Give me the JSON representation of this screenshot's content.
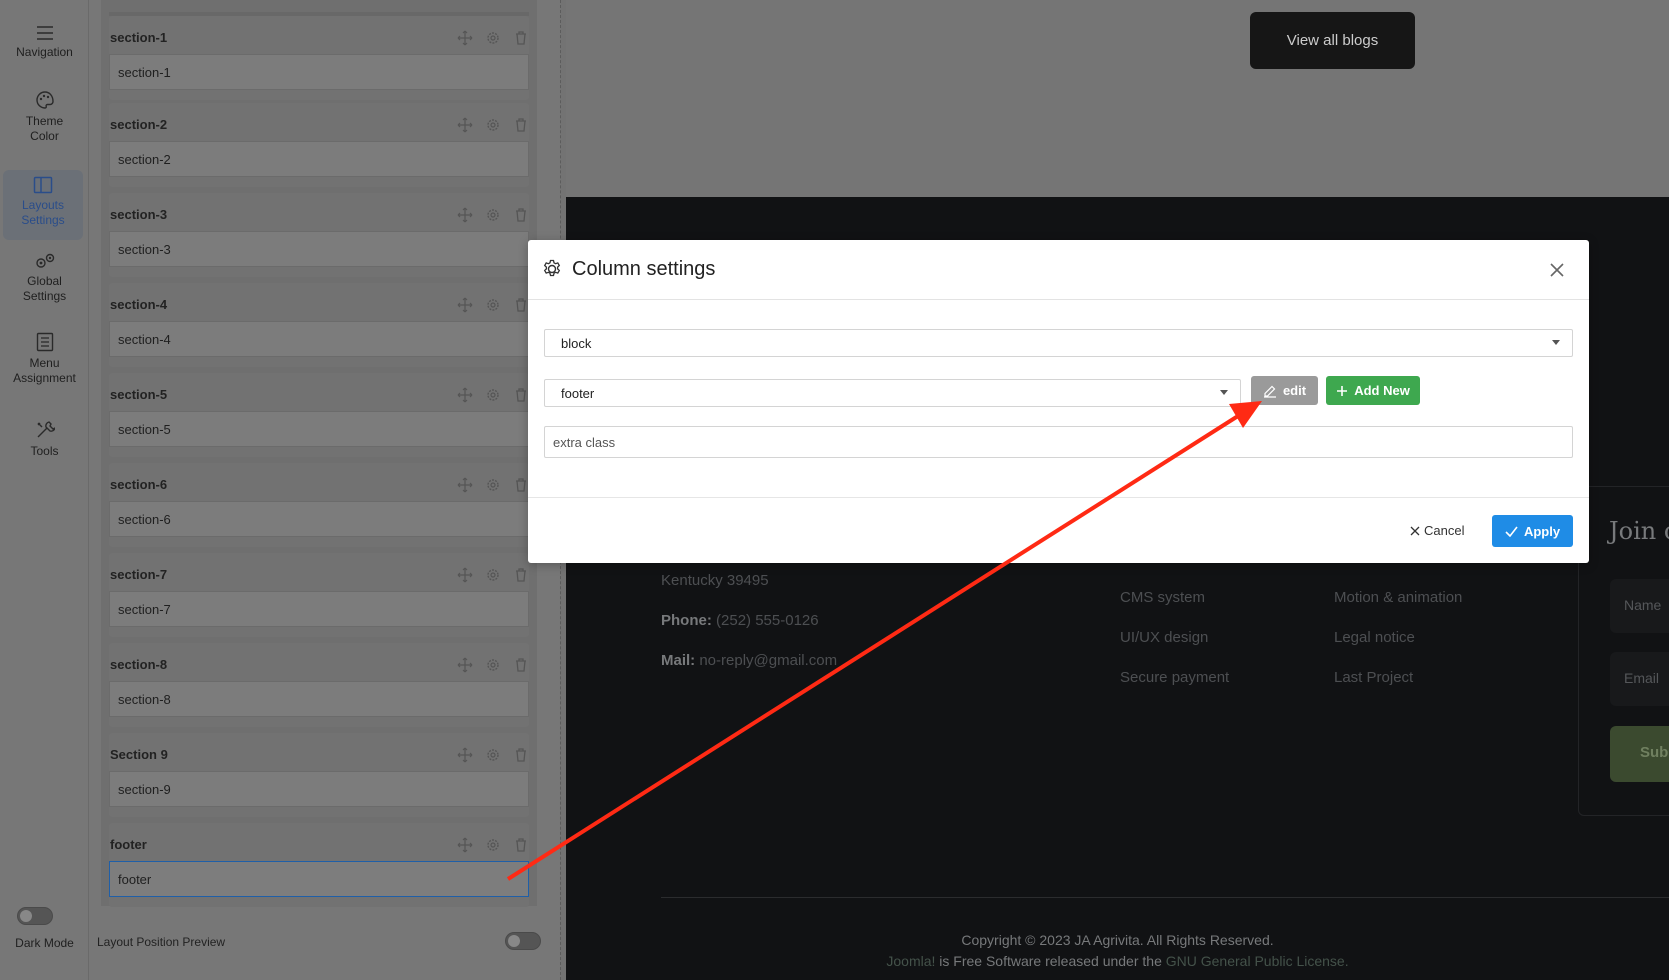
{
  "nav": {
    "items": [
      {
        "label": "Navigation",
        "icon": "hamburger-icon"
      },
      {
        "label": "Theme Color",
        "icon": "palette-icon"
      },
      {
        "label": "Layouts Settings",
        "icon": "layout-icon"
      },
      {
        "label": "Global Settings",
        "icon": "gears-icon"
      },
      {
        "label": "Menu Assignment",
        "icon": "list-icon"
      },
      {
        "label": "Tools",
        "icon": "tools-icon"
      }
    ],
    "dark_mode_label": "Dark Mode"
  },
  "layout_panel": {
    "sections": [
      {
        "title": "section-1",
        "value": "section-1"
      },
      {
        "title": "section-2",
        "value": "section-2"
      },
      {
        "title": "section-3",
        "value": "section-3"
      },
      {
        "title": "section-4",
        "value": "section-4"
      },
      {
        "title": "section-5",
        "value": "section-5"
      },
      {
        "title": "section-6",
        "value": "section-6"
      },
      {
        "title": "section-7",
        "value": "section-7"
      },
      {
        "title": "section-8",
        "value": "section-8"
      },
      {
        "title": "Section 9",
        "value": "section-9"
      },
      {
        "title": "footer",
        "value": "footer"
      }
    ],
    "preview_label": "Layout Position Preview"
  },
  "site": {
    "view_all_blogs": "View all blogs",
    "address_line": "Kentucky 39495",
    "phone_label": "Phone:",
    "phone_value": "(252) 555-0126",
    "mail_label": "Mail:",
    "mail_value": "no-reply@gmail.com",
    "links_col1": [
      "CMS system",
      "UI/UX design",
      "Secure payment"
    ],
    "links_col2": [
      "Motion & animation",
      "Legal notice",
      "Last Project"
    ],
    "join_title": "Join o",
    "name_placeholder": "Name",
    "email_placeholder": "Email",
    "subscribe_label": "Sub",
    "copyright": "Copyright © 2023 JA Agrivita. All Rights Reserved.",
    "license_link1": "Joomla!",
    "license_text": " is Free Software released under the ",
    "license_link2": "GNU General Public License."
  },
  "modal": {
    "title": "Column settings",
    "type_select": "block",
    "position_select": "footer",
    "edit_label": "edit",
    "add_new_label": "Add New",
    "extra_class_placeholder": "extra class",
    "cancel_label": "Cancel",
    "apply_label": "Apply"
  },
  "colors": {
    "apply": "#1f8ce6",
    "add_new": "#3ea84f",
    "edit": "#9a9a9a",
    "annotation_arrow": "#ff2a14"
  }
}
